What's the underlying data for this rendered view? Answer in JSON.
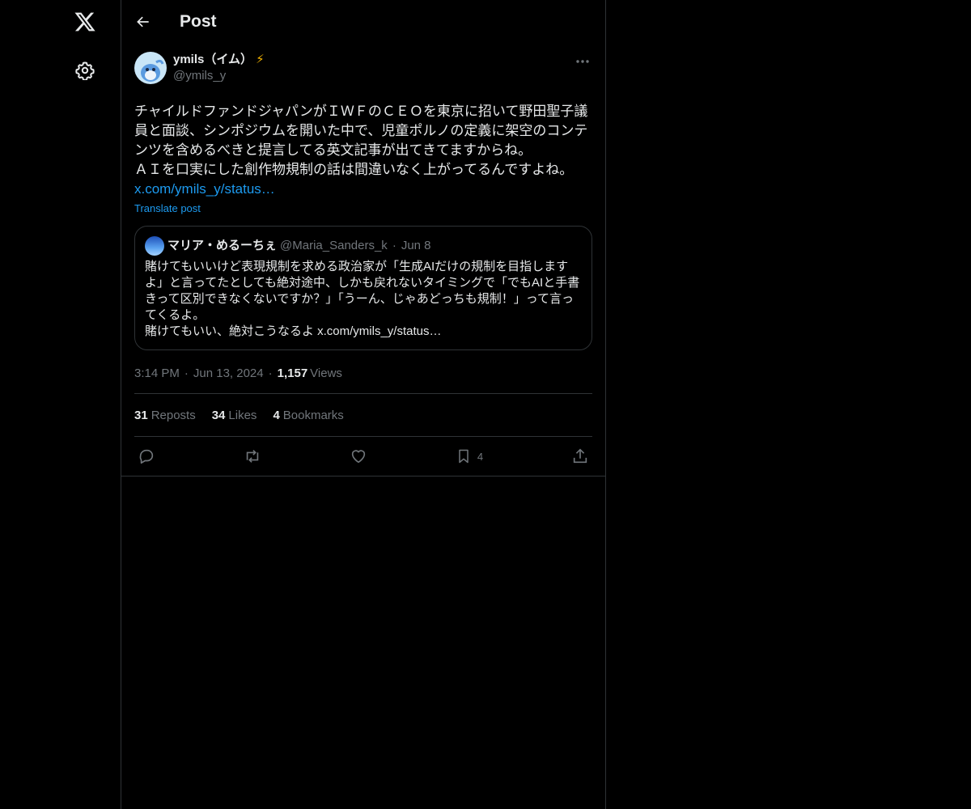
{
  "header": {
    "title": "Post"
  },
  "post": {
    "author_name": "ymils（イム）",
    "author_badge": "⚡",
    "author_handle": "@ymils_y",
    "text": "チャイルドファンドジャパンがＩＷＦのＣＥＯを東京に招いて野田聖子議員と面談、シンポジウムを開いた中で、児童ポルノの定義に架空のコンテンツを含めるべきと提言してる英文記事が出てきてますからね。\nＡＩを口実にした創作物規制の話は間違いなく上がってるんですよね。",
    "link": "x.com/ymils_y/status…",
    "translate_label": "Translate post"
  },
  "quote": {
    "name": "マリア・めるーちぇ",
    "handle": "@Maria_Sanders_k",
    "date": "Jun 8",
    "text": "賭けてもいいけど表現規制を求める政治家が「生成AIだけの規制を目指しますよ」と言ってたとしても絶対途中、しかも戻れないタイミングで「でもAIと手書きって区別できなくないですか？」「うーん、じゃあどっちも規制！」って言ってくるよ。\n賭けてもいい、絶対こうなるよ x.com/ymils_y/status…"
  },
  "meta": {
    "time": "3:14 PM",
    "date": "Jun 13, 2024",
    "views_count": "1,157",
    "views_label": "Views"
  },
  "stats": {
    "reposts_count": "31",
    "reposts_label": "Reposts",
    "likes_count": "34",
    "likes_label": "Likes",
    "bookmarks_count": "4",
    "bookmarks_label": "Bookmarks"
  },
  "actions": {
    "bookmark_count": "4"
  },
  "icons": {
    "logo": "x-logo-icon",
    "settings": "gear-icon",
    "back": "arrow-left-icon",
    "more": "more-dots-icon",
    "reply": "reply-icon",
    "repost": "repost-icon",
    "like": "heart-icon",
    "bookmark": "bookmark-icon",
    "share": "share-icon"
  },
  "colors": {
    "background": "#000000",
    "text": "#e7e9ea",
    "muted": "#71767b",
    "accent": "#1d9bf0",
    "border": "#2f3336"
  }
}
